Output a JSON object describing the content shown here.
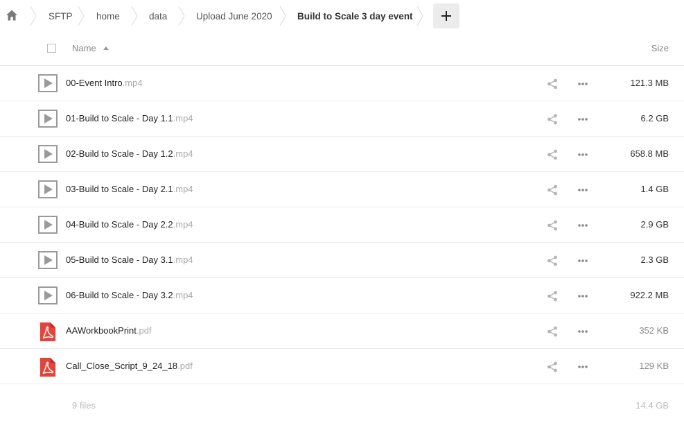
{
  "breadcrumbs": [
    {
      "label": "SFTP"
    },
    {
      "label": "home"
    },
    {
      "label": "data"
    },
    {
      "label": "Upload June 2020"
    },
    {
      "label": "Build to Scale 3 day event"
    }
  ],
  "header": {
    "name_label": "Name",
    "size_label": "Size",
    "sort_icon": "sort-ascending-icon"
  },
  "files": [
    {
      "basename": "00-Event Intro",
      "ext": ".mp4",
      "size": "121.3 MB",
      "icon": "video-file-icon"
    },
    {
      "basename": "01-Build to Scale - Day 1.1",
      "ext": ".mp4",
      "size": "6.2 GB",
      "icon": "video-file-icon"
    },
    {
      "basename": "02-Build to Scale - Day 1.2",
      "ext": ".mp4",
      "size": "658.8 MB",
      "icon": "video-file-icon"
    },
    {
      "basename": "03-Build to Scale - Day 2.1",
      "ext": ".mp4",
      "size": "1.4 GB",
      "icon": "video-file-icon"
    },
    {
      "basename": "04-Build to Scale - Day 2.2",
      "ext": ".mp4",
      "size": "2.9 GB",
      "icon": "video-file-icon"
    },
    {
      "basename": "05-Build to Scale - Day 3.1",
      "ext": ".mp4",
      "size": "2.3 GB",
      "icon": "video-file-icon"
    },
    {
      "basename": "06-Build to Scale - Day 3.2",
      "ext": ".mp4",
      "size": "922.2 MB",
      "icon": "video-file-icon"
    },
    {
      "basename": "AAWorkbookPrint",
      "ext": ".pdf",
      "size": "352 KB",
      "icon": "pdf-file-icon"
    },
    {
      "basename": "Call_Close_Script_9_24_18",
      "ext": ".pdf",
      "size": "129 KB",
      "icon": "pdf-file-icon"
    }
  ],
  "summary": {
    "count": "9 files",
    "total_size": "14.4 GB"
  },
  "colors": {
    "pdf_red": "#e2453c",
    "icon_gray": "#9a9a9a",
    "action_gray": "#b5b5b5"
  }
}
